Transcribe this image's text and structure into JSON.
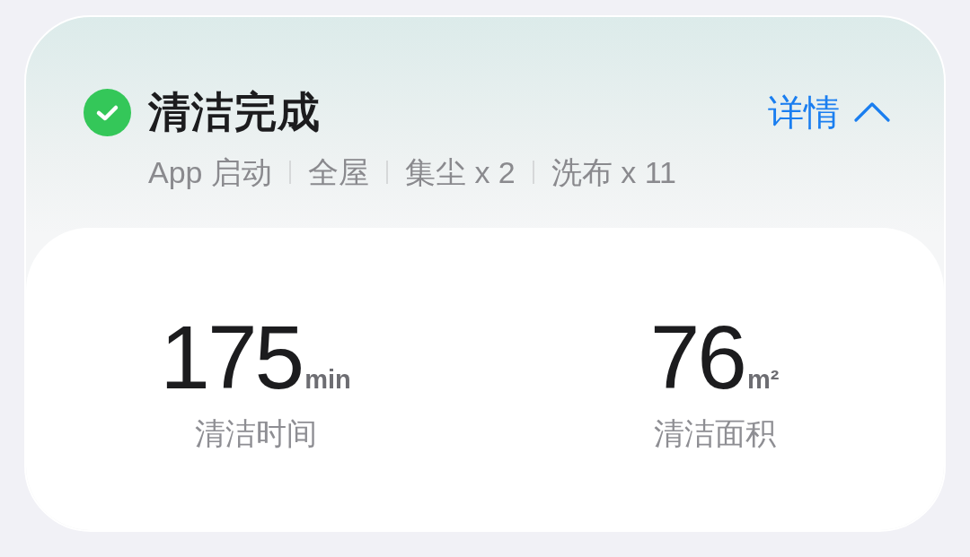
{
  "status": {
    "title": "清洁完成"
  },
  "details_link": {
    "label": "详情",
    "expanded": true
  },
  "tags": [
    "App 启动",
    "全屋",
    "集尘 x 2",
    "洗布 x 11"
  ],
  "stats": [
    {
      "value": "175",
      "unit": "min",
      "label": "清洁时间"
    },
    {
      "value": "76",
      "unit": "m²",
      "label": "清洁面积"
    }
  ]
}
